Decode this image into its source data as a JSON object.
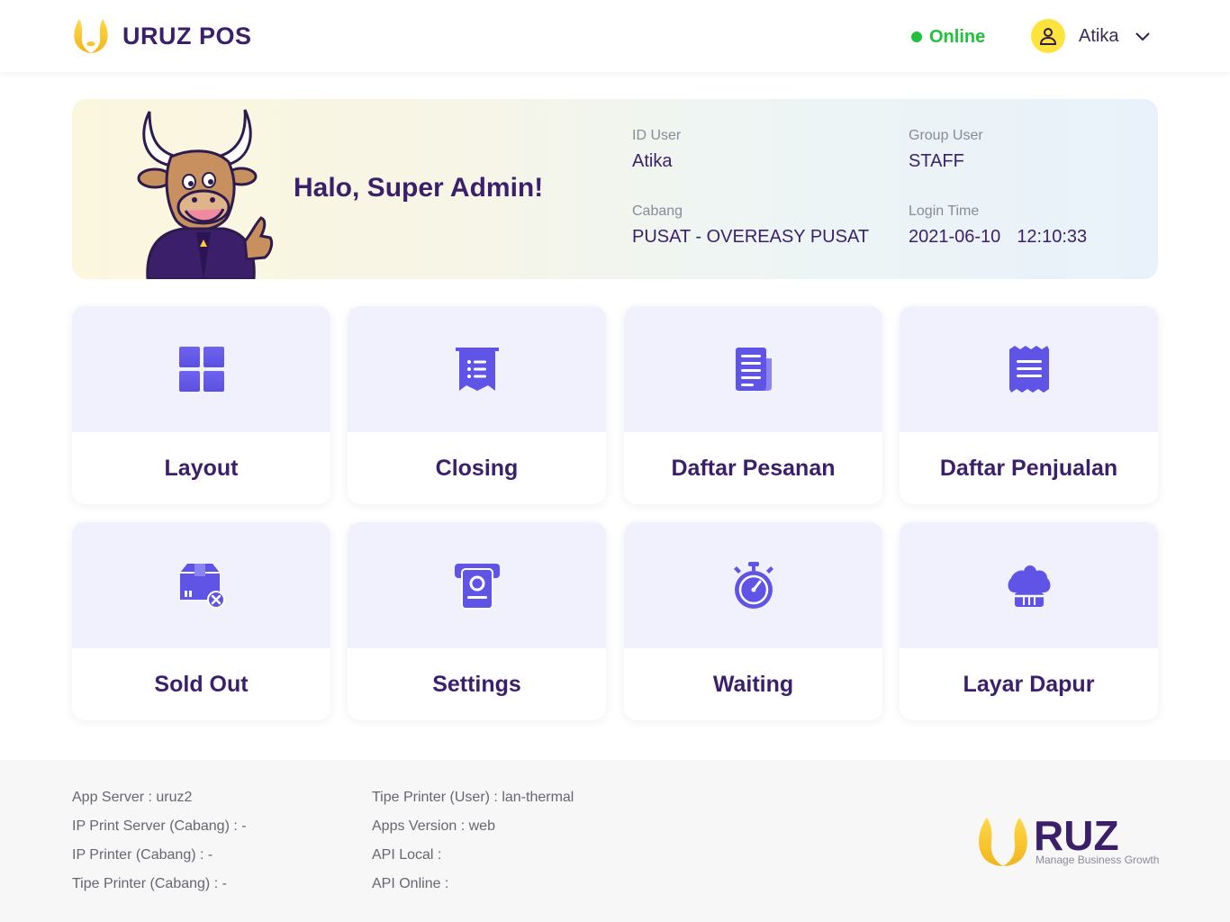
{
  "header": {
    "brand_name": "URUZ POS",
    "status_text": "Online",
    "user_name": "Atika",
    "colors": {
      "brand": "#3b1f6b",
      "online": "#22c03c",
      "accent": "#ffc93c"
    }
  },
  "banner": {
    "greeting": "Halo, Super Admin!",
    "id_user_label": "ID User",
    "id_user_value": "Atika",
    "group_label": "Group User",
    "group_value": "STAFF",
    "cabang_label": "Cabang",
    "cabang_value": "PUSAT - OVEREASY PUSAT",
    "login_label": "Login Time",
    "login_date": "2021-06-10",
    "login_time": "12:10:33"
  },
  "menu": [
    {
      "label": "Layout",
      "icon": "grid-icon"
    },
    {
      "label": "Closing",
      "icon": "receipt-list-icon"
    },
    {
      "label": "Daftar Pesanan",
      "icon": "document-list-icon"
    },
    {
      "label": "Daftar Penjualan",
      "icon": "sales-receipt-icon"
    },
    {
      "label": "Sold Out",
      "icon": "box-x-icon"
    },
    {
      "label": "Settings",
      "icon": "printer-settings-icon"
    },
    {
      "label": "Waiting",
      "icon": "stopwatch-icon"
    },
    {
      "label": "Layar Dapur",
      "icon": "chef-hat-icon"
    }
  ],
  "footer": {
    "left": [
      "App Server : uruz2",
      "IP Print Server (Cabang) : -",
      "IP Printer (Cabang) : -",
      "Tipe Printer (Cabang) : -"
    ],
    "right": [
      "Tipe Printer (User) : lan-thermal",
      "Apps Version : web",
      "API Local :",
      "API Online :"
    ],
    "logo_text": "RUZ",
    "tagline": "Manage Business Growth"
  }
}
